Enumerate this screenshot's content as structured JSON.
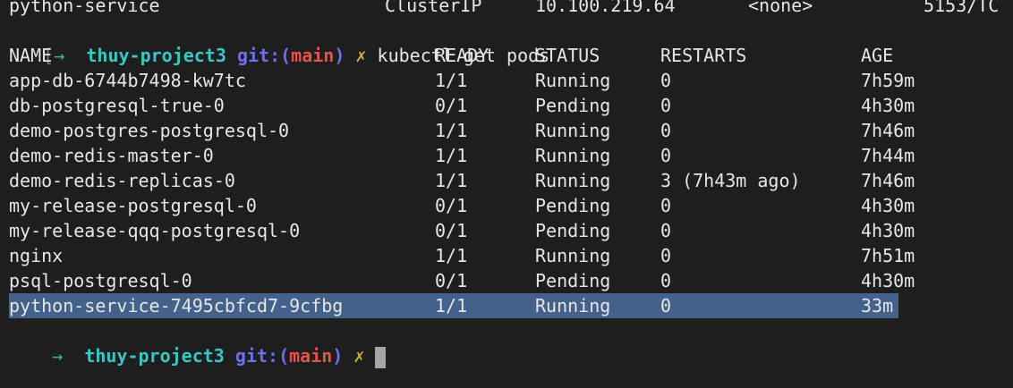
{
  "top_line": {
    "name": "python-service",
    "type": "ClusterIP",
    "cluster_ip": "10.100.219.64",
    "external_ip": "<none>",
    "ports": "5153/TC"
  },
  "prompt1": {
    "bracket": "[",
    "arrow": "→",
    "dir": "thuy-project3",
    "git_label": "git:(",
    "branch": "main",
    "git_close": ")",
    "x": "✗",
    "command": "kubectl get pods"
  },
  "headers": {
    "name": "NAME",
    "ready": "READY",
    "status": "STATUS",
    "restarts": "RESTARTS",
    "age": "AGE"
  },
  "pods": [
    {
      "name": "app-db-6744b7498-kw7tc",
      "ready": "1/1",
      "status": "Running",
      "restarts": "0",
      "age": "7h59m"
    },
    {
      "name": "db-postgresql-true-0",
      "ready": "0/1",
      "status": "Pending",
      "restarts": "0",
      "age": "4h30m"
    },
    {
      "name": "demo-postgres-postgresql-0",
      "ready": "1/1",
      "status": "Running",
      "restarts": "0",
      "age": "7h46m"
    },
    {
      "name": "demo-redis-master-0",
      "ready": "1/1",
      "status": "Running",
      "restarts": "0",
      "age": "7h44m"
    },
    {
      "name": "demo-redis-replicas-0",
      "ready": "1/1",
      "status": "Running",
      "restarts": "3 (7h43m ago)",
      "age": "7h46m"
    },
    {
      "name": "my-release-postgresql-0",
      "ready": "0/1",
      "status": "Pending",
      "restarts": "0",
      "age": "4h30m"
    },
    {
      "name": "my-release-qqq-postgresql-0",
      "ready": "0/1",
      "status": "Pending",
      "restarts": "0",
      "age": "4h30m"
    },
    {
      "name": "nginx",
      "ready": "1/1",
      "status": "Running",
      "restarts": "0",
      "age": "7h51m"
    },
    {
      "name": "psql-postgresql-0",
      "ready": "0/1",
      "status": "Pending",
      "restarts": "0",
      "age": "4h30m"
    },
    {
      "name": "python-service-7495cbfcd7-9cfbg",
      "ready": "1/1",
      "status": "Running",
      "restarts": "0",
      "age": "33m"
    }
  ],
  "prompt2": {
    "arrow": "→",
    "dir": "thuy-project3",
    "git_label": "git:(",
    "branch": "main",
    "git_close": ")",
    "x": "✗"
  },
  "colors": {
    "background": "#1e1e1e",
    "text": "#e6e6e6",
    "arrow": "#2ec27e",
    "dir": "#3bc6c6",
    "git": "#6e6ef0",
    "branch": "#e65050",
    "dirty_mark": "#c9b23a",
    "selection": "#43618a"
  },
  "icons": {
    "prompt_arrow": "arrow-right-icon",
    "dirty_mark": "x-mark-icon",
    "cursor": "block-cursor"
  }
}
